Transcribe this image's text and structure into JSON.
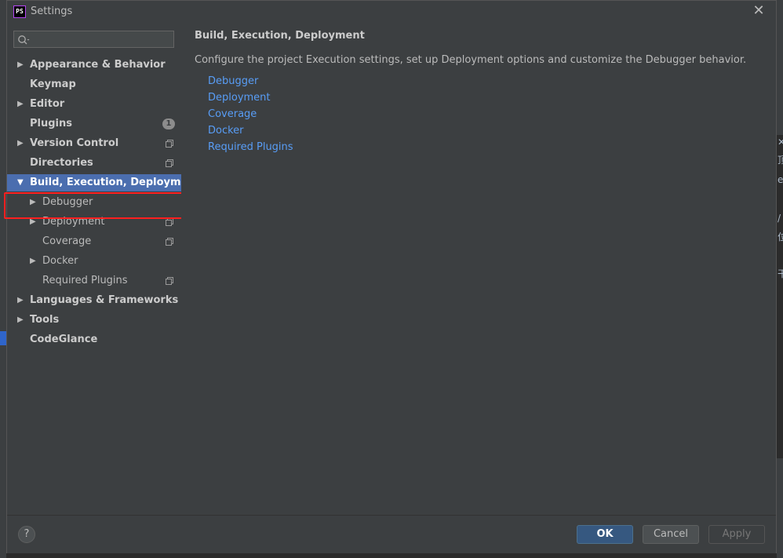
{
  "window": {
    "title": "Settings",
    "app_icon_text": "PS"
  },
  "search": {
    "placeholder": ""
  },
  "sidebar": {
    "items": [
      {
        "label": "Appearance & Behavior",
        "arrow": "▶"
      },
      {
        "label": "Keymap"
      },
      {
        "label": "Editor",
        "arrow": "▶"
      },
      {
        "label": "Plugins",
        "badge": "1"
      },
      {
        "label": "Version Control",
        "arrow": "▶"
      },
      {
        "label": "Directories"
      },
      {
        "label": "Build, Execution, Deployment",
        "arrow": "▼"
      },
      {
        "label": "Debugger",
        "arrow": "▶"
      },
      {
        "label": "Deployment",
        "arrow": "▶"
      },
      {
        "label": "Coverage"
      },
      {
        "label": "Docker",
        "arrow": "▶"
      },
      {
        "label": "Required Plugins"
      },
      {
        "label": "Languages & Frameworks",
        "arrow": "▶"
      },
      {
        "label": "Tools",
        "arrow": "▶"
      },
      {
        "label": "CodeGlance"
      }
    ]
  },
  "content": {
    "heading": "Build, Execution, Deployment",
    "description": "Configure the project Execution settings, set up Deployment options and customize the Debugger behavior.",
    "links": [
      "Debugger",
      "Deployment",
      "Coverage",
      "Docker",
      "Required Plugins"
    ]
  },
  "footer": {
    "help": "?",
    "ok": "OK",
    "cancel": "Cancel",
    "apply": "Apply"
  },
  "colors": {
    "selection": "#4b6eaf",
    "link": "#589df6",
    "highlight_box": "#ff1f1f",
    "ok_button": "#365880"
  },
  "background_glyphs": [
    "✕",
    "顶",
    "e",
    "/",
    "位",
    "干"
  ]
}
